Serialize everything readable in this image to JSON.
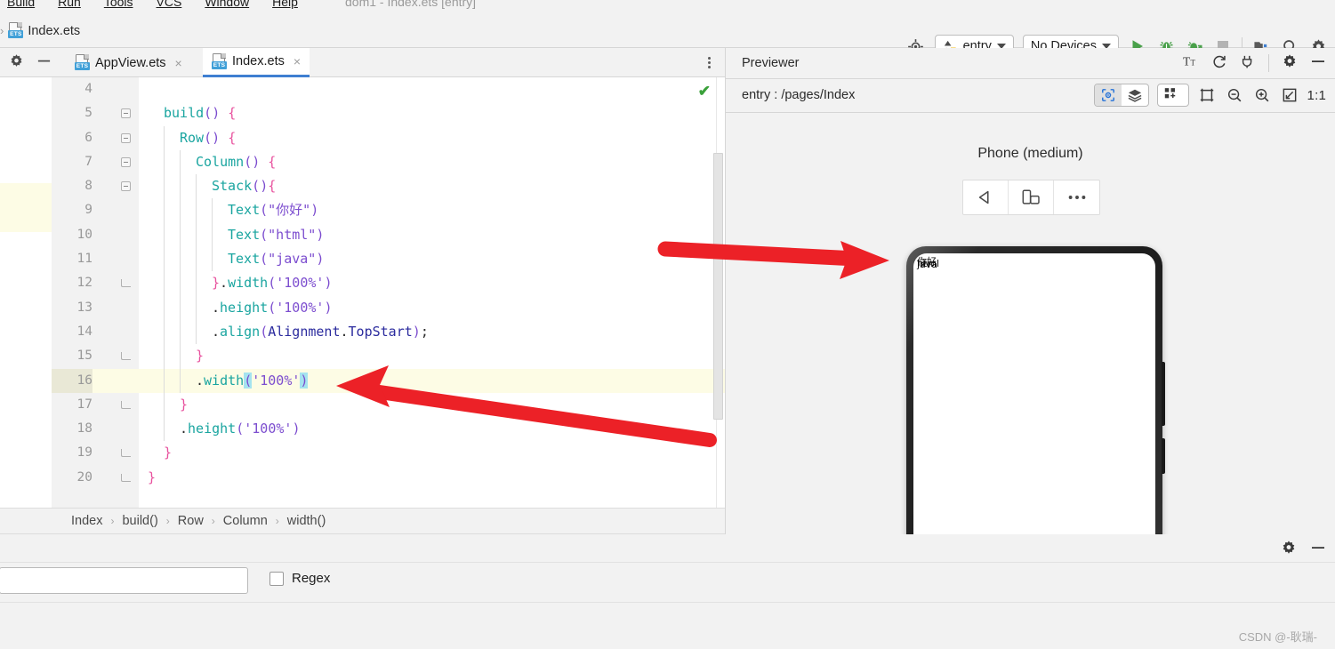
{
  "window": {
    "title": "dom1 - Index.ets [entry]",
    "menu": [
      "Build",
      "Run",
      "Tools",
      "VCS",
      "Window",
      "Help"
    ]
  },
  "nav": {
    "leading_sep": "›",
    "file_name": "Index.ets",
    "file_icon": "ets-file-icon",
    "icon_label": "ETS"
  },
  "toolbar": {
    "target_icon": "target-icon",
    "module_chip": "entry",
    "device_chip": "No Devices",
    "run_icon": "run-play-icon",
    "debug_icon": "debug-bug-icon",
    "attach_icon": "attach-debugger-icon",
    "stop_icon": "stop-icon",
    "project_icon": "project-structure-icon",
    "search_icon": "search-icon",
    "settings_icon": "gear-icon"
  },
  "editor": {
    "gear_icon": "gear-icon",
    "minimize_icon": "minimize-icon",
    "overflow_icon": "tab-overflow-icon",
    "tabs": [
      {
        "label": "AppView.ets",
        "active": false,
        "close": "×"
      },
      {
        "label": "Index.ets",
        "active": true,
        "close": "×"
      }
    ],
    "inspection_status": "✔",
    "first_visible_line": 4,
    "current_line": 16,
    "breadcrumb": [
      "Index",
      "build()",
      "Row",
      "Column",
      "width()"
    ],
    "breadcrumb_sep": "›",
    "lines": [
      {
        "n": 4,
        "fold": "",
        "indent": 0,
        "text": ""
      },
      {
        "n": 5,
        "fold": "open",
        "indent": 1,
        "text": "build() {"
      },
      {
        "n": 6,
        "fold": "open",
        "indent": 2,
        "text": "Row() {"
      },
      {
        "n": 7,
        "fold": "open",
        "indent": 3,
        "text": "Column() {"
      },
      {
        "n": 8,
        "fold": "open",
        "indent": 4,
        "text": "Stack(){"
      },
      {
        "n": 9,
        "fold": "",
        "indent": 5,
        "text": "Text(\"你好\")"
      },
      {
        "n": 10,
        "fold": "",
        "indent": 5,
        "text": "Text(\"html\")"
      },
      {
        "n": 11,
        "fold": "",
        "indent": 5,
        "text": "Text(\"java\")"
      },
      {
        "n": 12,
        "fold": "close",
        "indent": 4,
        "text": "}.width('100%')"
      },
      {
        "n": 13,
        "fold": "",
        "indent": 4,
        "text": ".height('100%')"
      },
      {
        "n": 14,
        "fold": "",
        "indent": 4,
        "text": ".align(Alignment.TopStart);"
      },
      {
        "n": 15,
        "fold": "close",
        "indent": 3,
        "text": "}"
      },
      {
        "n": 16,
        "fold": "",
        "indent": 3,
        "text": ".width('100%')"
      },
      {
        "n": 17,
        "fold": "close",
        "indent": 2,
        "text": "}"
      },
      {
        "n": 18,
        "fold": "",
        "indent": 2,
        "text": ".height('100%')"
      },
      {
        "n": 19,
        "fold": "close",
        "indent": 1,
        "text": "}"
      },
      {
        "n": 20,
        "fold": "close",
        "indent": 0,
        "text": "}"
      }
    ]
  },
  "previewer": {
    "title": "Previewer",
    "head_icons": [
      "font-size-icon",
      "refresh-icon",
      "plug-off-icon",
      "gear-icon",
      "minimize-icon"
    ],
    "path": "entry : /pages/Index",
    "inspector_icon": "inspector-icon",
    "layers_icon": "layers-icon",
    "grid_icon": "multi-device-grid-icon",
    "caret_icon": "chevron-down-icon",
    "frame_icon": "device-frame-icon",
    "zoom_out_icon": "zoom-out-icon",
    "zoom_in_icon": "zoom-in-icon",
    "fit_icon": "fit-to-window-icon",
    "zoom_ratio": "1:1",
    "device_name": "Phone (medium)",
    "device_buttons": [
      "rotate-back-icon",
      "orientation-icon",
      "more-icon"
    ],
    "preview_texts": [
      "你好",
      "html",
      "java"
    ]
  },
  "bottom_panel": {
    "gear_icon": "gear-icon",
    "minimize_icon": "minimize-icon",
    "search_value": "",
    "search_placeholder": "",
    "regex_label": "Regex",
    "regex_checked": false
  },
  "watermark": "CSDN @-耿瑞-",
  "colors": {
    "accent_blue": "#3f7fd1",
    "function_teal": "#1aa5a0",
    "paren_purple": "#7c4dcf",
    "brace_pink": "#e8529e",
    "string_purple": "#7c4dcf",
    "identifier_blue": "#2b2b9e",
    "selection_cyan": "#a5e3ef",
    "current_line_yellow": "#fdfce5",
    "arrow_red": "#ec2127",
    "run_green": "#4caf50"
  }
}
